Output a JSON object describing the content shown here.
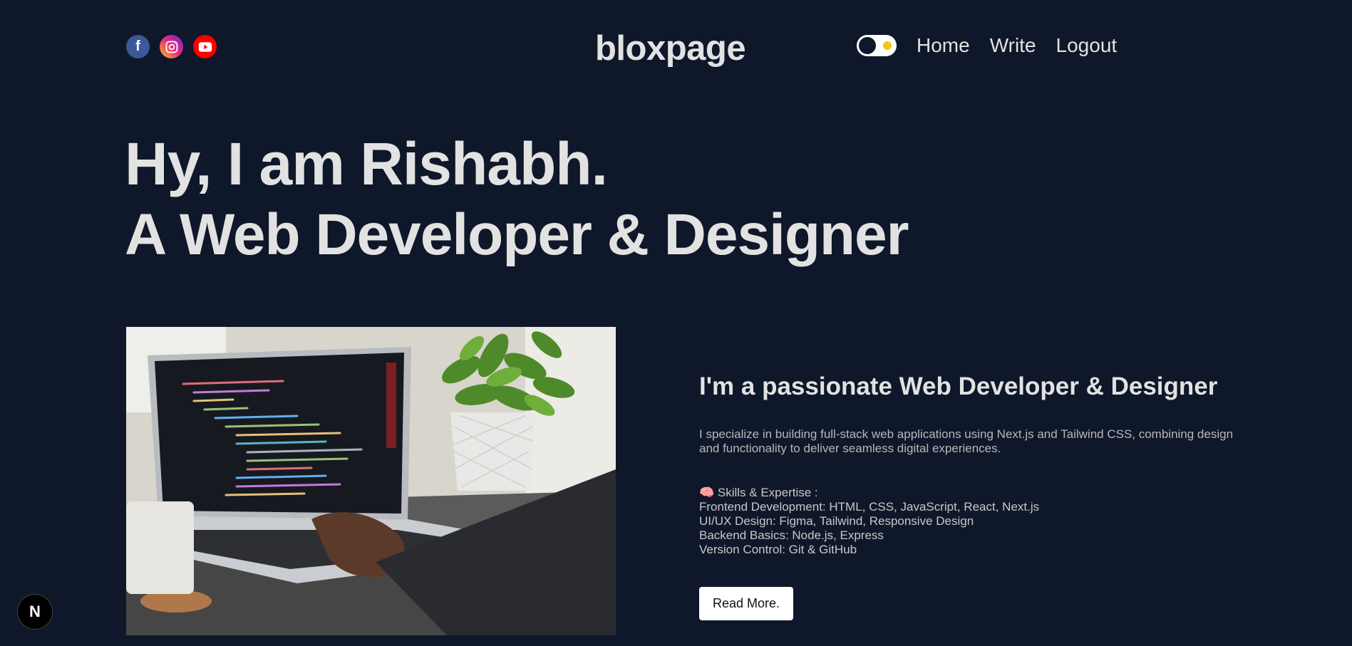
{
  "nav": {
    "logo": "bloxpage",
    "socials": [
      {
        "name": "facebook",
        "glyph": "f"
      },
      {
        "name": "instagram",
        "glyph": ""
      },
      {
        "name": "youtube",
        "glyph": ""
      }
    ],
    "links": [
      "Home",
      "Write",
      "Logout"
    ],
    "theme_toggle": "dark-mode-toggle"
  },
  "hero": {
    "line1": "Hy, I am Rishabh.",
    "line2": "A Web Developer & Designer"
  },
  "about": {
    "heading": "I'm a passionate Web Developer & Designer",
    "description": "I specialize in building full-stack web applications using Next.js and Tailwind CSS, combining design and functionality to deliver seamless digital experiences.",
    "skills_title": "🧠 Skills & Expertise :",
    "skills": [
      "Frontend Development: HTML, CSS, JavaScript, React, Next.js",
      "UI/UX Design: Figma, Tailwind, Responsive Design",
      "Backend Basics: Node.js, Express",
      "Version Control: Git & GitHub"
    ],
    "cta": "Read More."
  },
  "badge": {
    "label": "N"
  },
  "colors": {
    "background": "#0f172a",
    "text": "#e2e2e2",
    "facebook": "#3b5998",
    "youtube": "#ff0000"
  }
}
